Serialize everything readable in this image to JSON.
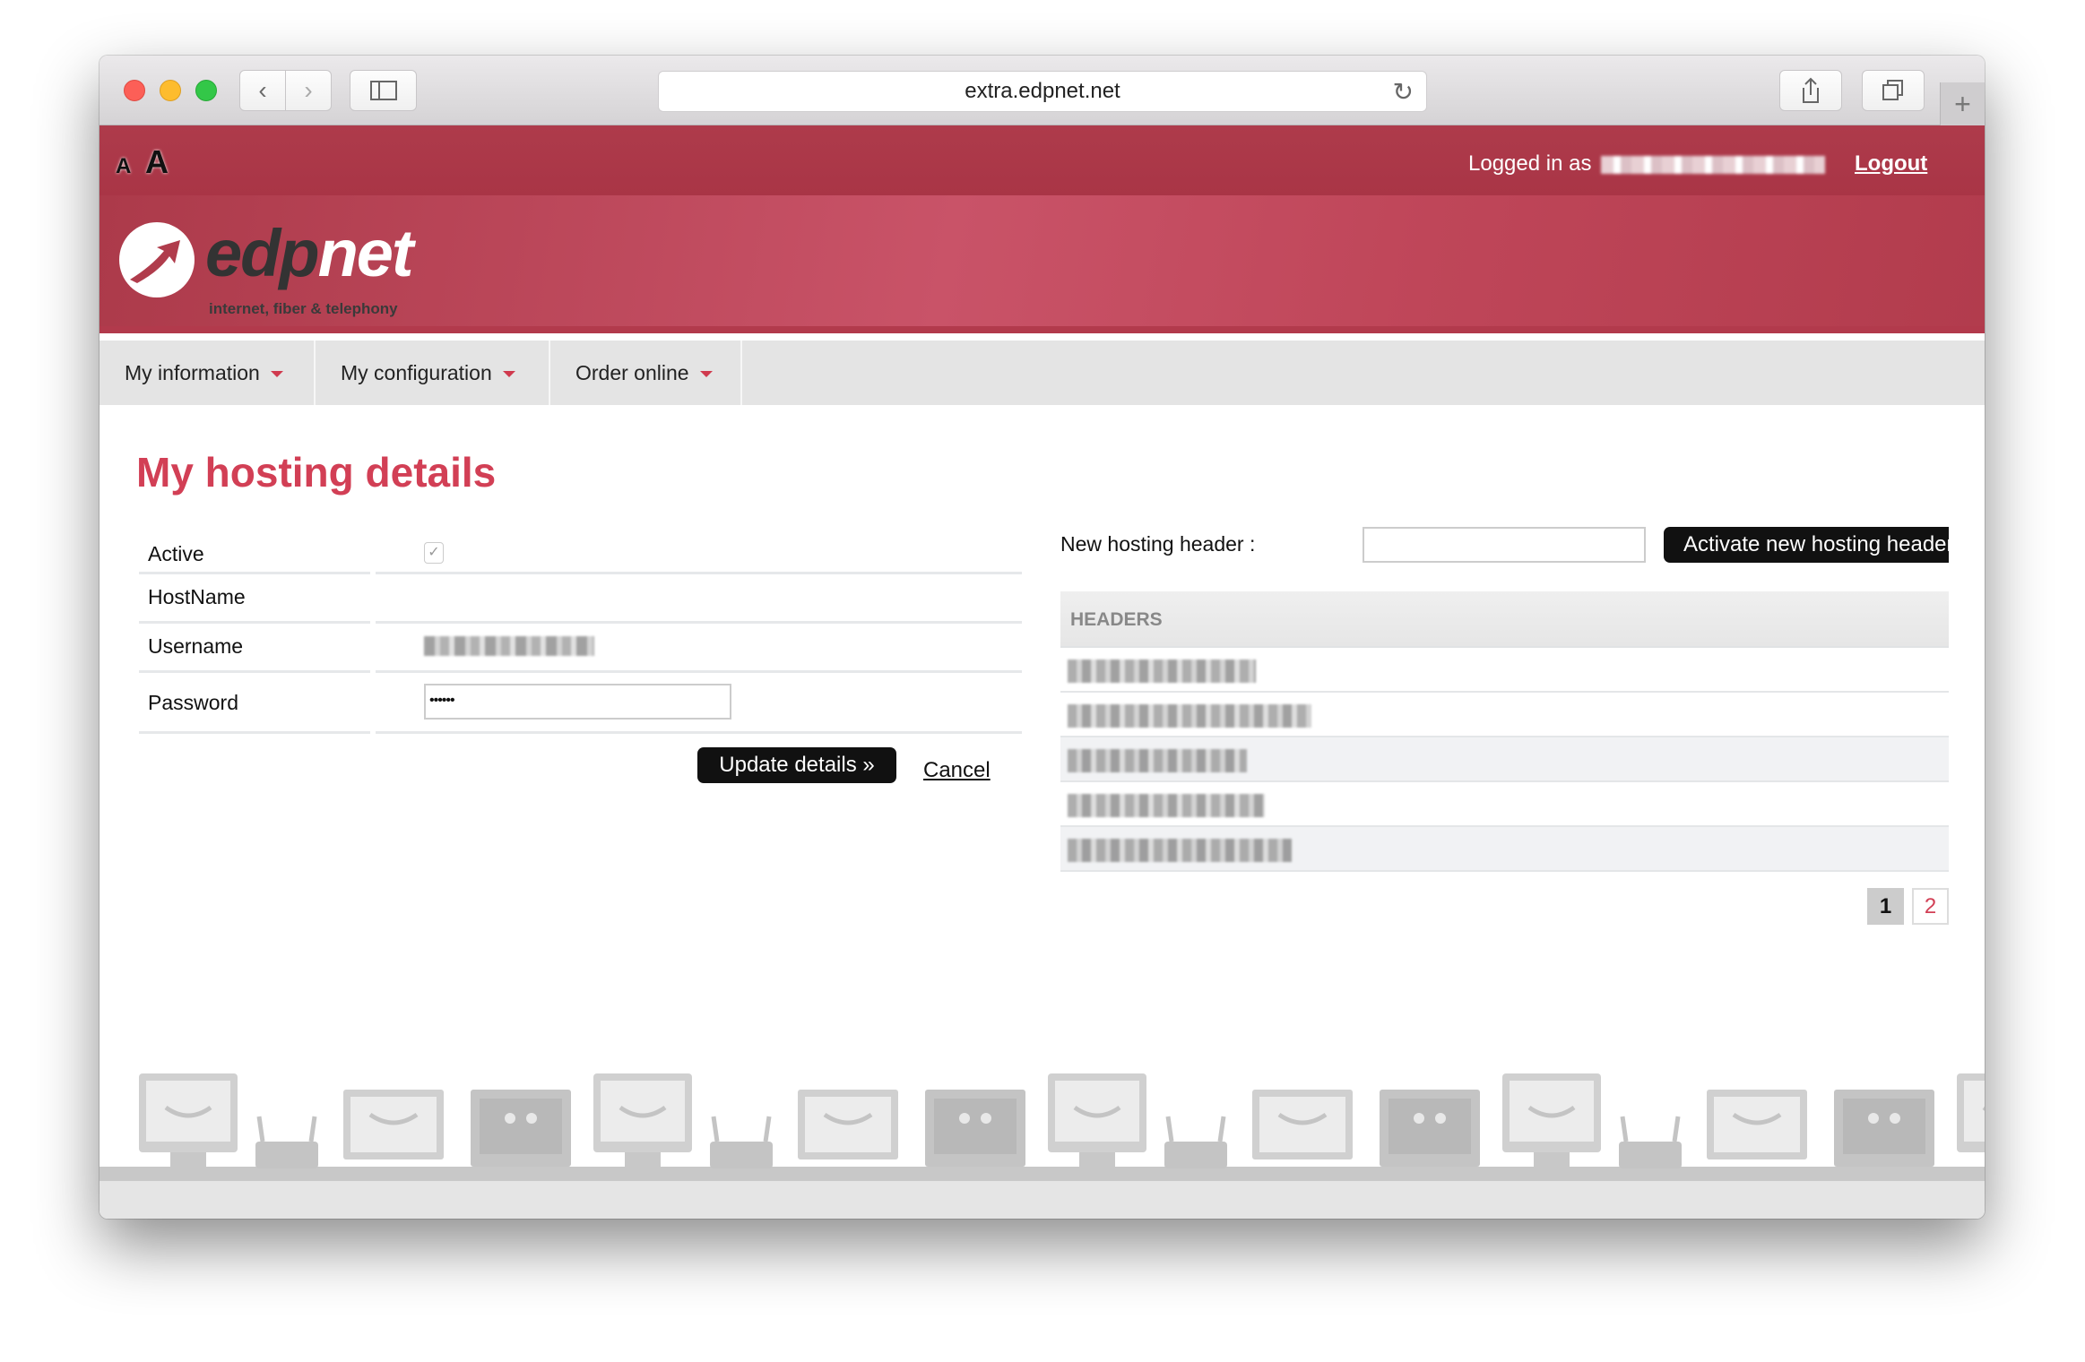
{
  "browser": {
    "url": "extra.edpnet.net",
    "icons": [
      "back-icon",
      "forward-icon",
      "sidebar-icon",
      "reload-icon",
      "share-icon",
      "tabs-icon",
      "plus-icon"
    ]
  },
  "topbar": {
    "font_small": "A",
    "font_large": "A",
    "logged_in_label": "Logged in as",
    "logout": "Logout"
  },
  "logo": {
    "name": "edpnet",
    "name_dark": "edp",
    "name_light": "net",
    "tagline": "internet, fiber & telephony"
  },
  "nav": {
    "items": [
      {
        "label": "My information"
      },
      {
        "label": "My configuration"
      },
      {
        "label": "Order online"
      }
    ]
  },
  "page": {
    "title": "My hosting details",
    "form": {
      "active_label": "Active",
      "active_checked": true,
      "hostname_label": "HostName",
      "username_label": "Username",
      "password_label": "Password",
      "password_value": "••••••",
      "update_button": "Update details »",
      "cancel": "Cancel"
    },
    "headers_panel": {
      "new_header_label": "New hosting header :",
      "new_header_value": "",
      "activate_button": "Activate new hosting header",
      "column": "HEADERS",
      "pagination": {
        "current": "1",
        "pages": [
          "1",
          "2"
        ]
      }
    }
  },
  "colors": {
    "brand_red": "#ad3a4a",
    "title_red": "#d23f55",
    "button_black": "#111111"
  }
}
